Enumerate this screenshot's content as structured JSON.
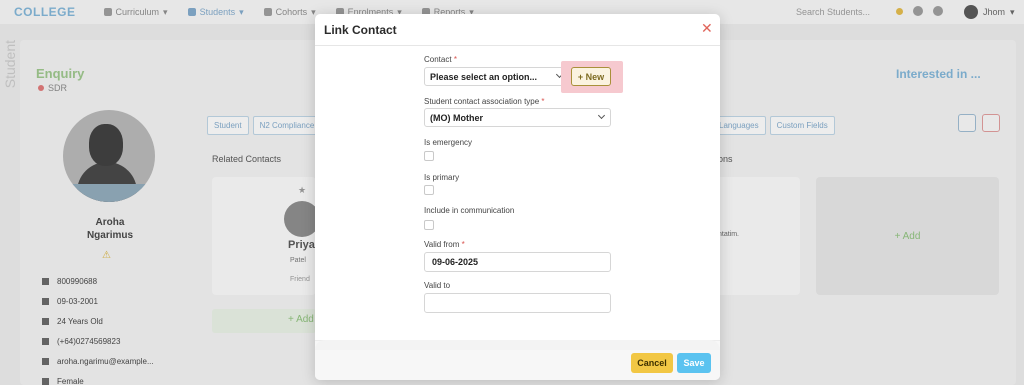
{
  "background": {
    "logo": "COLLEGE",
    "nav": [
      "Curriculum",
      "Students",
      "Cohorts",
      "Enrolments",
      "Reports"
    ],
    "search_placeholder": "Search Students...",
    "user": "Jhom",
    "side_label": "Student",
    "title": "Enquiry",
    "sub_title": "SDR",
    "status": "Interested in ...",
    "profile_name_line1": "Aroha",
    "profile_name_line2": "Ngarimus",
    "info": [
      "800990688",
      "09-03-2001",
      "24 Years Old",
      "(+64)0274569823",
      "aroha.ngarimu@example...",
      "Female"
    ],
    "tabs_left": [
      "Student",
      "N2 Compliance"
    ],
    "tabs_right": [
      "Languages",
      "Custom Fields"
    ],
    "related_contacts_label": "Related Contacts",
    "related_right_label": "ons",
    "contact_card": {
      "name": "Priya",
      "sub": "Patel",
      "relation": "Friend"
    },
    "card_right_text": "ntatim.",
    "add_label": "+ Add",
    "add_bar_label": "+ Add"
  },
  "modal": {
    "title": "Link Contact",
    "close_symbol": "✕",
    "fields": {
      "contact": {
        "label": "Contact",
        "value": "Please select an option..."
      },
      "new_button": "+ New",
      "association_type": {
        "label": "Student contact association type",
        "value": "(MO) Mother"
      },
      "is_emergency": {
        "label": "Is emergency",
        "checked": false
      },
      "is_primary": {
        "label": "Is primary",
        "checked": false
      },
      "include_in_communication": {
        "label": "Include in communication",
        "checked": false
      },
      "valid_from": {
        "label": "Valid from",
        "value": "09-06-2025"
      },
      "valid_to": {
        "label": "Valid to",
        "value": ""
      }
    },
    "cancel_label": "Cancel",
    "save_label": "Save",
    "required_marker": "*"
  },
  "colors": {
    "cancel": "#f2c744",
    "save": "#5bc3f0",
    "highlight": "#f6c9cf",
    "close": "#e0645a"
  }
}
